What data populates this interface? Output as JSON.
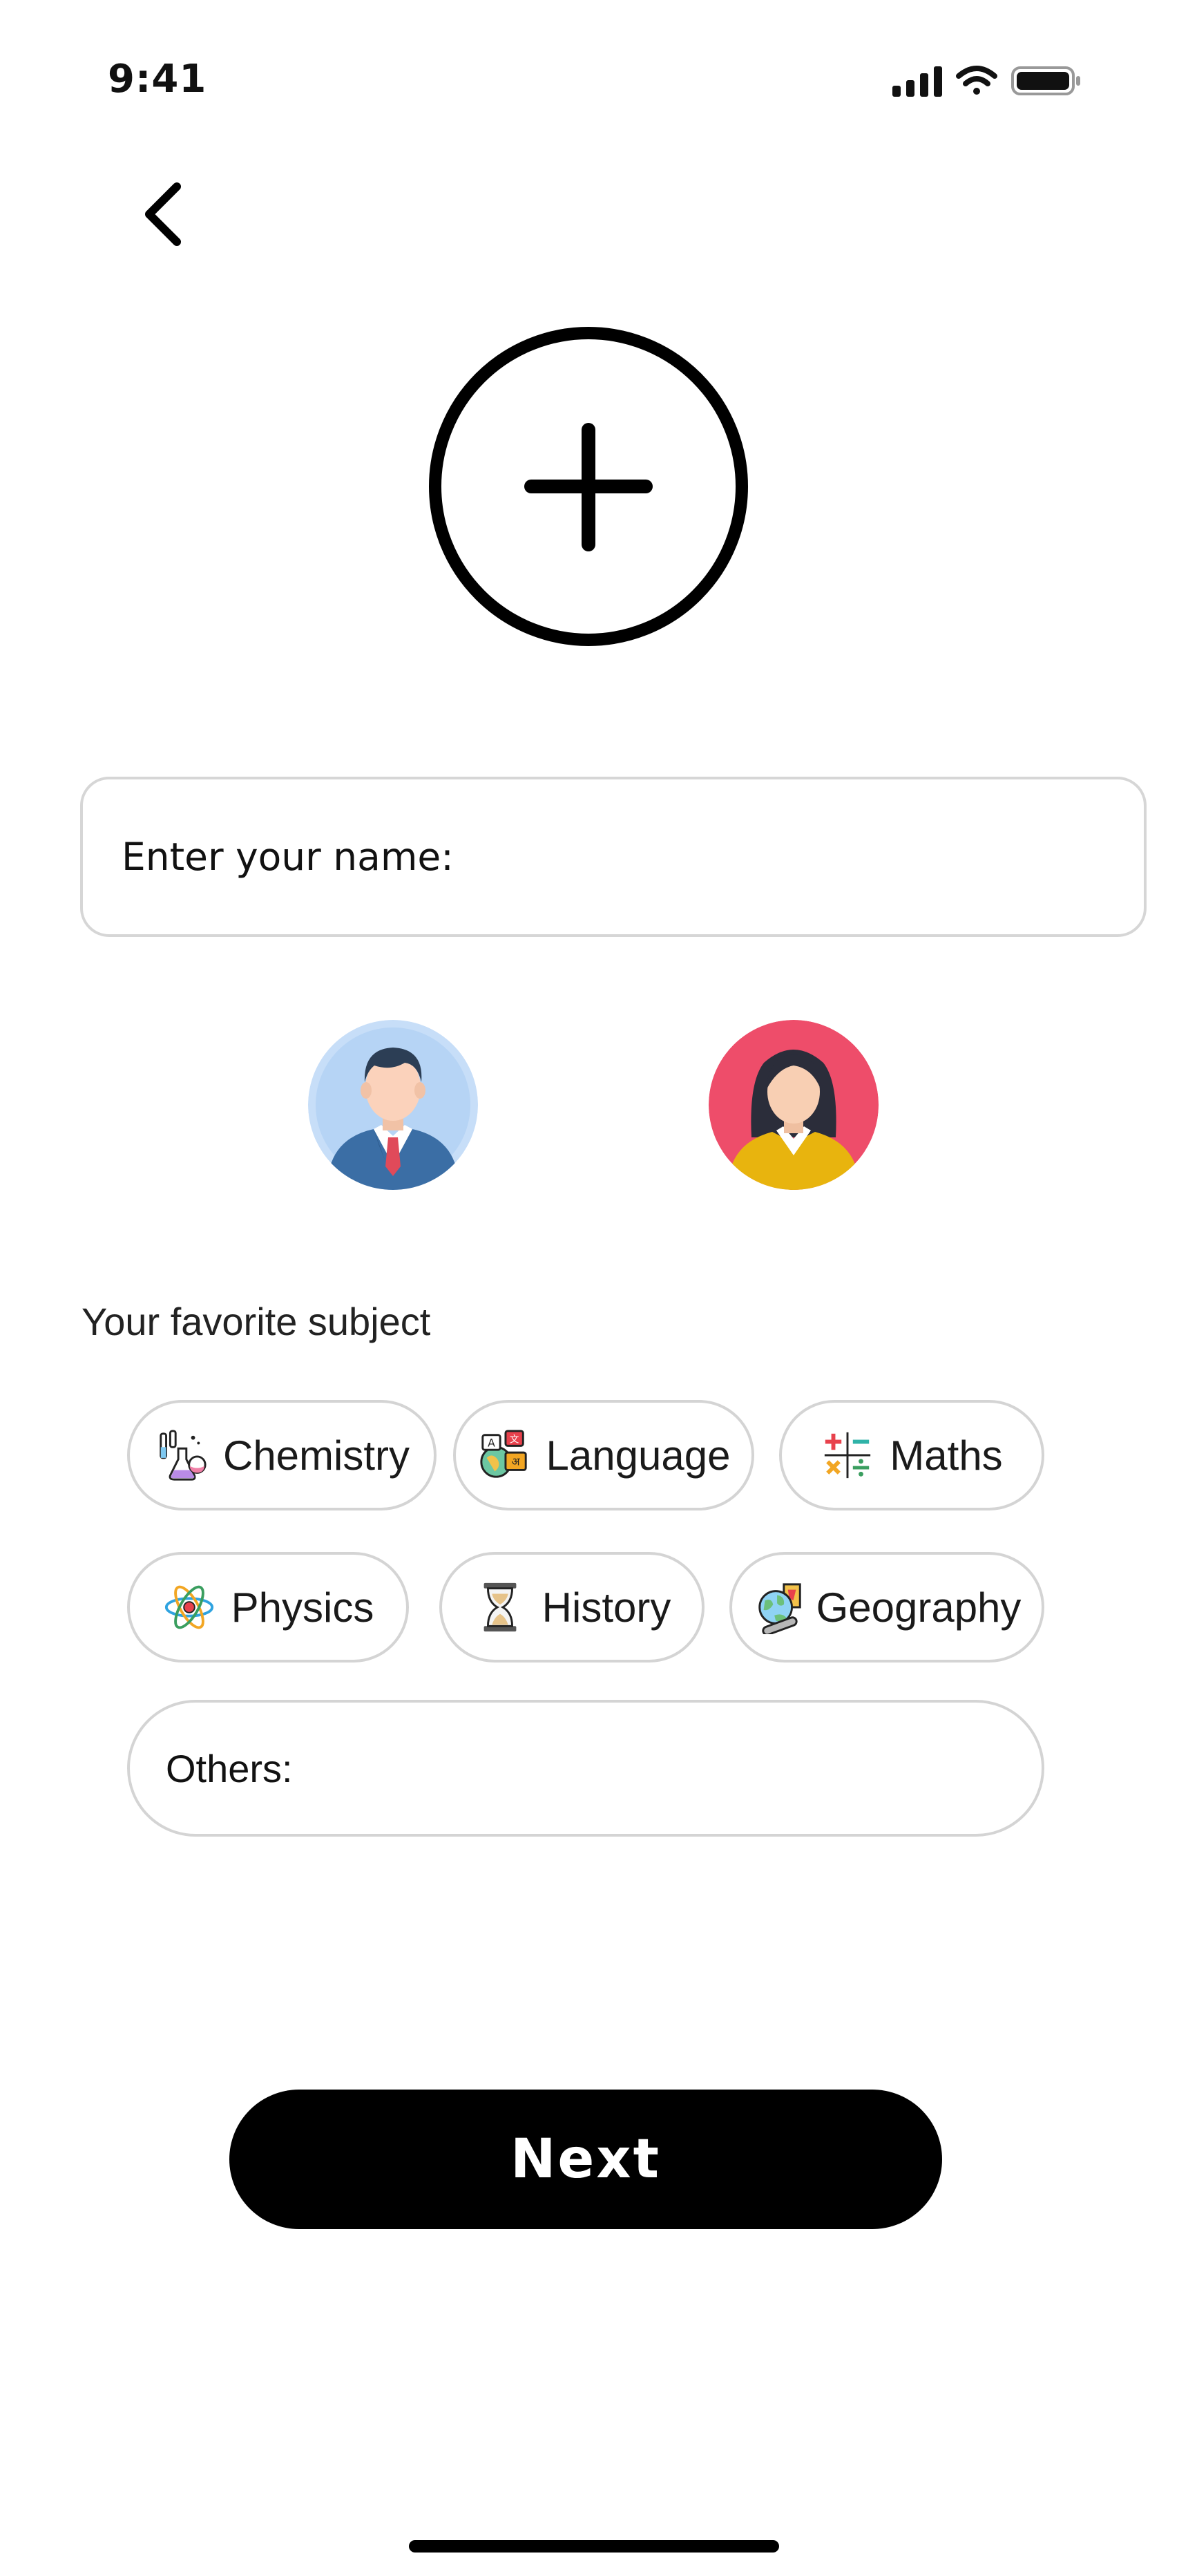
{
  "status_bar": {
    "time": "9:41"
  },
  "header": {
    "back_icon": "chevron-left-icon"
  },
  "profile": {
    "add_photo_icon": "plus-circle-icon",
    "name_placeholder": "Enter your name:"
  },
  "avatars": [
    {
      "name": "male-avatar",
      "bg": "#c7def8"
    },
    {
      "name": "female-avatar",
      "bg": "#ee4d6a"
    }
  ],
  "subjects": {
    "heading": "Your favorite subject",
    "chips": [
      {
        "label": "Chemistry",
        "icon": "flask-icon"
      },
      {
        "label": "Language",
        "icon": "language-icon"
      },
      {
        "label": "Maths",
        "icon": "math-symbols-icon"
      },
      {
        "label": "Physics",
        "icon": "atom-icon"
      },
      {
        "label": "History",
        "icon": "hourglass-icon"
      },
      {
        "label": "Geography",
        "icon": "globe-map-icon"
      }
    ],
    "others_placeholder": "Others:"
  },
  "next_button": {
    "label": "Next"
  }
}
